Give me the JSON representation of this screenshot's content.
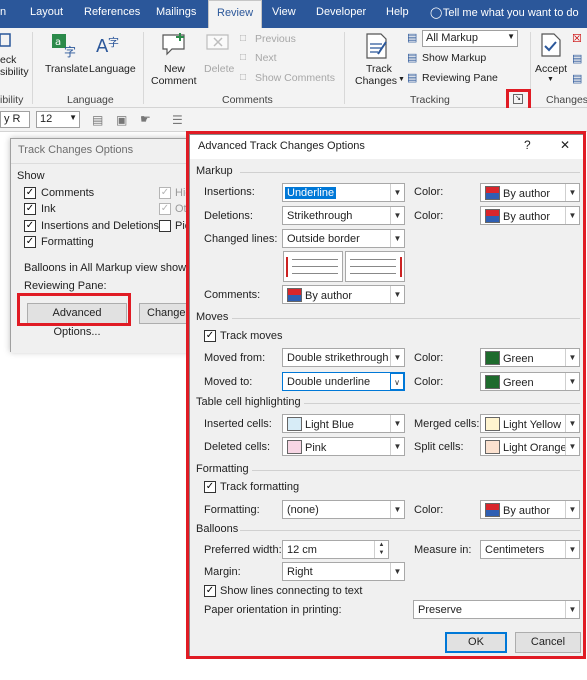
{
  "ribbon": {
    "tabs": [
      "n",
      "Layout",
      "References",
      "Mailings",
      "Review",
      "View",
      "Developer",
      "Help"
    ],
    "tell_me": "Tell me what you want to do",
    "left_cut": {
      "line1": "eck",
      "line2": "sibility",
      "line3": "ibility"
    },
    "translate": "Translate",
    "language": "Language",
    "language_group": "Language",
    "new_comment": {
      "line1": "New",
      "line2": "Comment"
    },
    "delete": "Delete",
    "previous": "Previous",
    "next": "Next",
    "show_comments": "Show Comments",
    "comments_group": "Comments",
    "track_changes": {
      "line1": "Track",
      "line2": "Changes"
    },
    "all_markup": "All Markup",
    "show_markup": "Show Markup",
    "reviewing_pane": "Reviewing Pane",
    "tracking_group": "Tracking",
    "accept": "Accept",
    "changes_group": "Changes",
    "font_name": "y R",
    "font_size": "12"
  },
  "track_changes_dialog": {
    "title": "Track Changes Options",
    "show_label": "Show",
    "checks": [
      {
        "label": "Comments",
        "checked": true
      },
      {
        "label": "Ink",
        "checked": true
      },
      {
        "label": "Insertions and Deletions",
        "checked": true
      },
      {
        "label": "Formatting",
        "checked": true
      }
    ],
    "right_checks": [
      {
        "label": "Hig",
        "checked": true
      },
      {
        "label": "Oth",
        "checked": true
      },
      {
        "label": "Pic",
        "checked": false
      }
    ],
    "balloons_label": "Balloons in All Markup view show:",
    "reviewing_pane_label": "Reviewing Pane:",
    "advanced_button": "Advanced Options...",
    "change_user_button": "Change U"
  },
  "advanced_dialog": {
    "title": "Advanced Track Changes Options",
    "help": "?",
    "close": "✕",
    "markup": {
      "section": "Markup",
      "insertions_label": "Insertions:",
      "insertions_value": "Underline",
      "deletions_label": "Deletions:",
      "deletions_value": "Strikethrough",
      "changed_lines_label": "Changed lines:",
      "changed_lines_value": "Outside border",
      "comments_label": "Comments:",
      "comments_value": "By author",
      "color_label": "Color:",
      "insertions_color": "By author",
      "deletions_color": "By author"
    },
    "moves": {
      "section": "Moves",
      "track_moves": "Track moves",
      "moved_from_label": "Moved from:",
      "moved_from_value": "Double strikethrough",
      "moved_from_color": "Green",
      "moved_to_label": "Moved to:",
      "moved_to_value": "Double underline",
      "moved_to_color": "Green",
      "color_label": "Color:"
    },
    "table": {
      "section": "Table cell highlighting",
      "inserted_label": "Inserted cells:",
      "inserted_value": "Light Blue",
      "deleted_label": "Deleted cells:",
      "deleted_value": "Pink",
      "merged_label": "Merged cells:",
      "merged_value": "Light Yellow",
      "split_label": "Split cells:",
      "split_value": "Light Orange"
    },
    "formatting": {
      "section": "Formatting",
      "track_formatting": "Track formatting",
      "formatting_label": "Formatting:",
      "formatting_value": "(none)",
      "color_label": "Color:",
      "color_value": "By author"
    },
    "balloons": {
      "section": "Balloons",
      "preferred_width_label": "Preferred width:",
      "preferred_width_value": "12 cm",
      "measure_in_label": "Measure in:",
      "measure_in_value": "Centimeters",
      "margin_label": "Margin:",
      "margin_value": "Right",
      "show_lines": "Show lines connecting to text",
      "paper_orientation_label": "Paper orientation in printing:",
      "paper_orientation_value": "Preserve"
    },
    "ok": "OK",
    "cancel": "Cancel"
  },
  "colors": {
    "ribbon_blue": "#2b579a",
    "highlight_red": "#e01b24",
    "by_author_red": "#d9262c",
    "by_author_blue": "#2f5fb3",
    "green": "#1e6b2d",
    "light_blue": "#d7ecf7",
    "pink": "#f7d6e4",
    "light_yellow": "#fff4cf",
    "light_orange": "#fbe1cf"
  }
}
